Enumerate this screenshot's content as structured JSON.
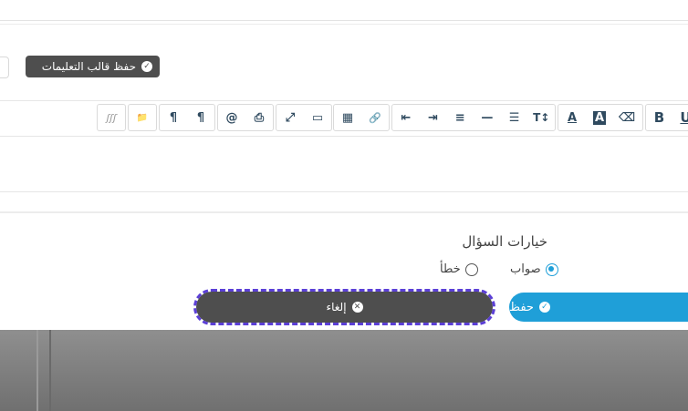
{
  "header": {
    "save_template_label": "حفظ قالب التعليمات"
  },
  "toolbar": {
    "groups": [
      [
        "ʃʃʃ"
      ],
      [
        "📁"
      ],
      [
        "¶",
        "¶"
      ],
      [
        "@",
        "⎙"
      ],
      [
        "⤢",
        "▭"
      ],
      [
        "▦",
        "🔗"
      ],
      [
        "⇤",
        "⇥",
        "≡",
        "—",
        "☰",
        "T↕"
      ],
      [
        "A",
        "A",
        "⌫"
      ],
      [
        "B",
        "U"
      ]
    ]
  },
  "options": {
    "title": "خيارات السؤال",
    "correct_label": "صواب",
    "wrong_label": "خطأ",
    "selected": "correct"
  },
  "buttons": {
    "save_label": "حفظ",
    "cancel_label": "إلغاء"
  },
  "colors": {
    "primary": "#1f9fd8",
    "dark": "#4e4e4e",
    "focus": "#5b3fd6"
  }
}
